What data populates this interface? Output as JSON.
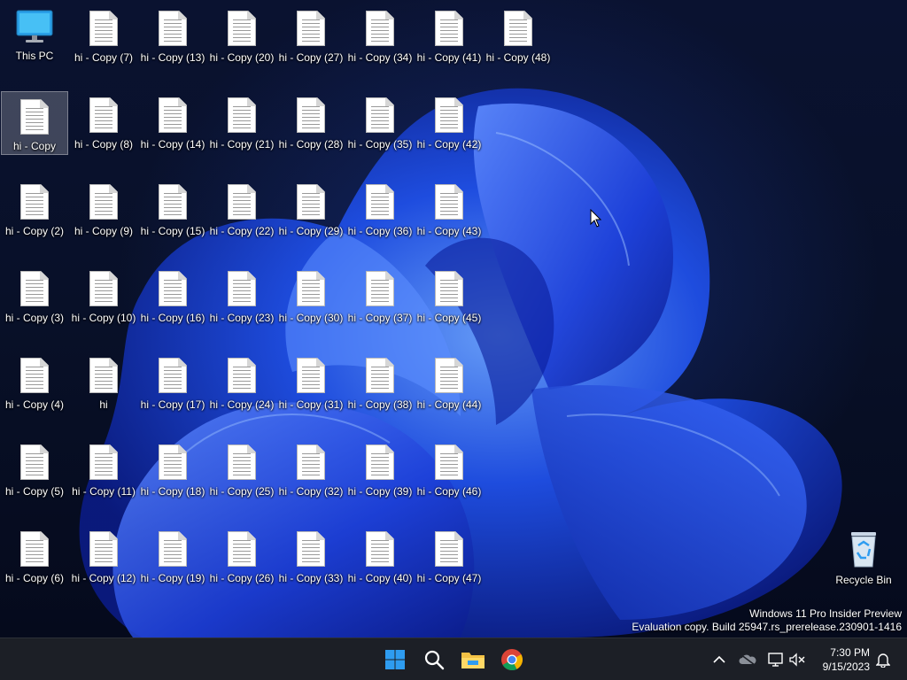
{
  "desktop": {
    "this_pc": "This PC",
    "recycle_bin": "Recycle Bin",
    "selected_file": "hi - Copy",
    "plain_file": "hi",
    "files": {
      "copy2": "hi - Copy (2)",
      "copy3": "hi - Copy (3)",
      "copy4": "hi - Copy (4)",
      "copy5": "hi - Copy (5)",
      "copy6": "hi - Copy (6)",
      "copy7": "hi - Copy (7)",
      "copy8": "hi - Copy (8)",
      "copy9": "hi - Copy (9)",
      "copy10": "hi - Copy (10)",
      "copy11": "hi - Copy (11)",
      "copy12": "hi - Copy (12)",
      "copy13": "hi - Copy (13)",
      "copy14": "hi - Copy (14)",
      "copy15": "hi - Copy (15)",
      "copy16": "hi - Copy (16)",
      "copy17": "hi - Copy (17)",
      "copy18": "hi - Copy (18)",
      "copy19": "hi - Copy (19)",
      "copy20": "hi - Copy (20)",
      "copy21": "hi - Copy (21)",
      "copy22": "hi - Copy (22)",
      "copy23": "hi - Copy (23)",
      "copy24": "hi - Copy (24)",
      "copy25": "hi - Copy (25)",
      "copy26": "hi - Copy (26)",
      "copy27": "hi - Copy (27)",
      "copy28": "hi - Copy (28)",
      "copy29": "hi - Copy (29)",
      "copy30": "hi - Copy (30)",
      "copy31": "hi - Copy (31)",
      "copy32": "hi - Copy (32)",
      "copy33": "hi - Copy (33)",
      "copy34": "hi - Copy (34)",
      "copy35": "hi - Copy (35)",
      "copy36": "hi - Copy (36)",
      "copy37": "hi - Copy (37)",
      "copy38": "hi - Copy (38)",
      "copy39": "hi - Copy (39)",
      "copy40": "hi - Copy (40)",
      "copy41": "hi - Copy (41)",
      "copy42": "hi - Copy (42)",
      "copy43": "hi - Copy (43)",
      "copy44": "hi - Copy (44)",
      "copy45": "hi - Copy (45)",
      "copy46": "hi - Copy (46)",
      "copy47": "hi - Copy (47)",
      "copy48": "hi - Copy (48)"
    }
  },
  "watermark": {
    "line1": "Windows 11 Pro Insider Preview",
    "line2": "Evaluation copy. Build 25947.rs_prerelease.230901-1416"
  },
  "taskbar": {
    "pinned_icons": [
      "start-icon",
      "search-icon",
      "file-explorer-icon",
      "chrome-icon"
    ],
    "tray_icons": [
      "chevron-up-icon",
      "onedrive-icon",
      "network-icon",
      "volume-muted-icon",
      "notification-bell-icon"
    ],
    "time": "7:30 PM",
    "date": "9/15/2023"
  },
  "colors": {
    "taskbar_bg": "#1c1f26",
    "windows_blue": "#2e9cf0",
    "folder_yellow": "#f4c245"
  }
}
